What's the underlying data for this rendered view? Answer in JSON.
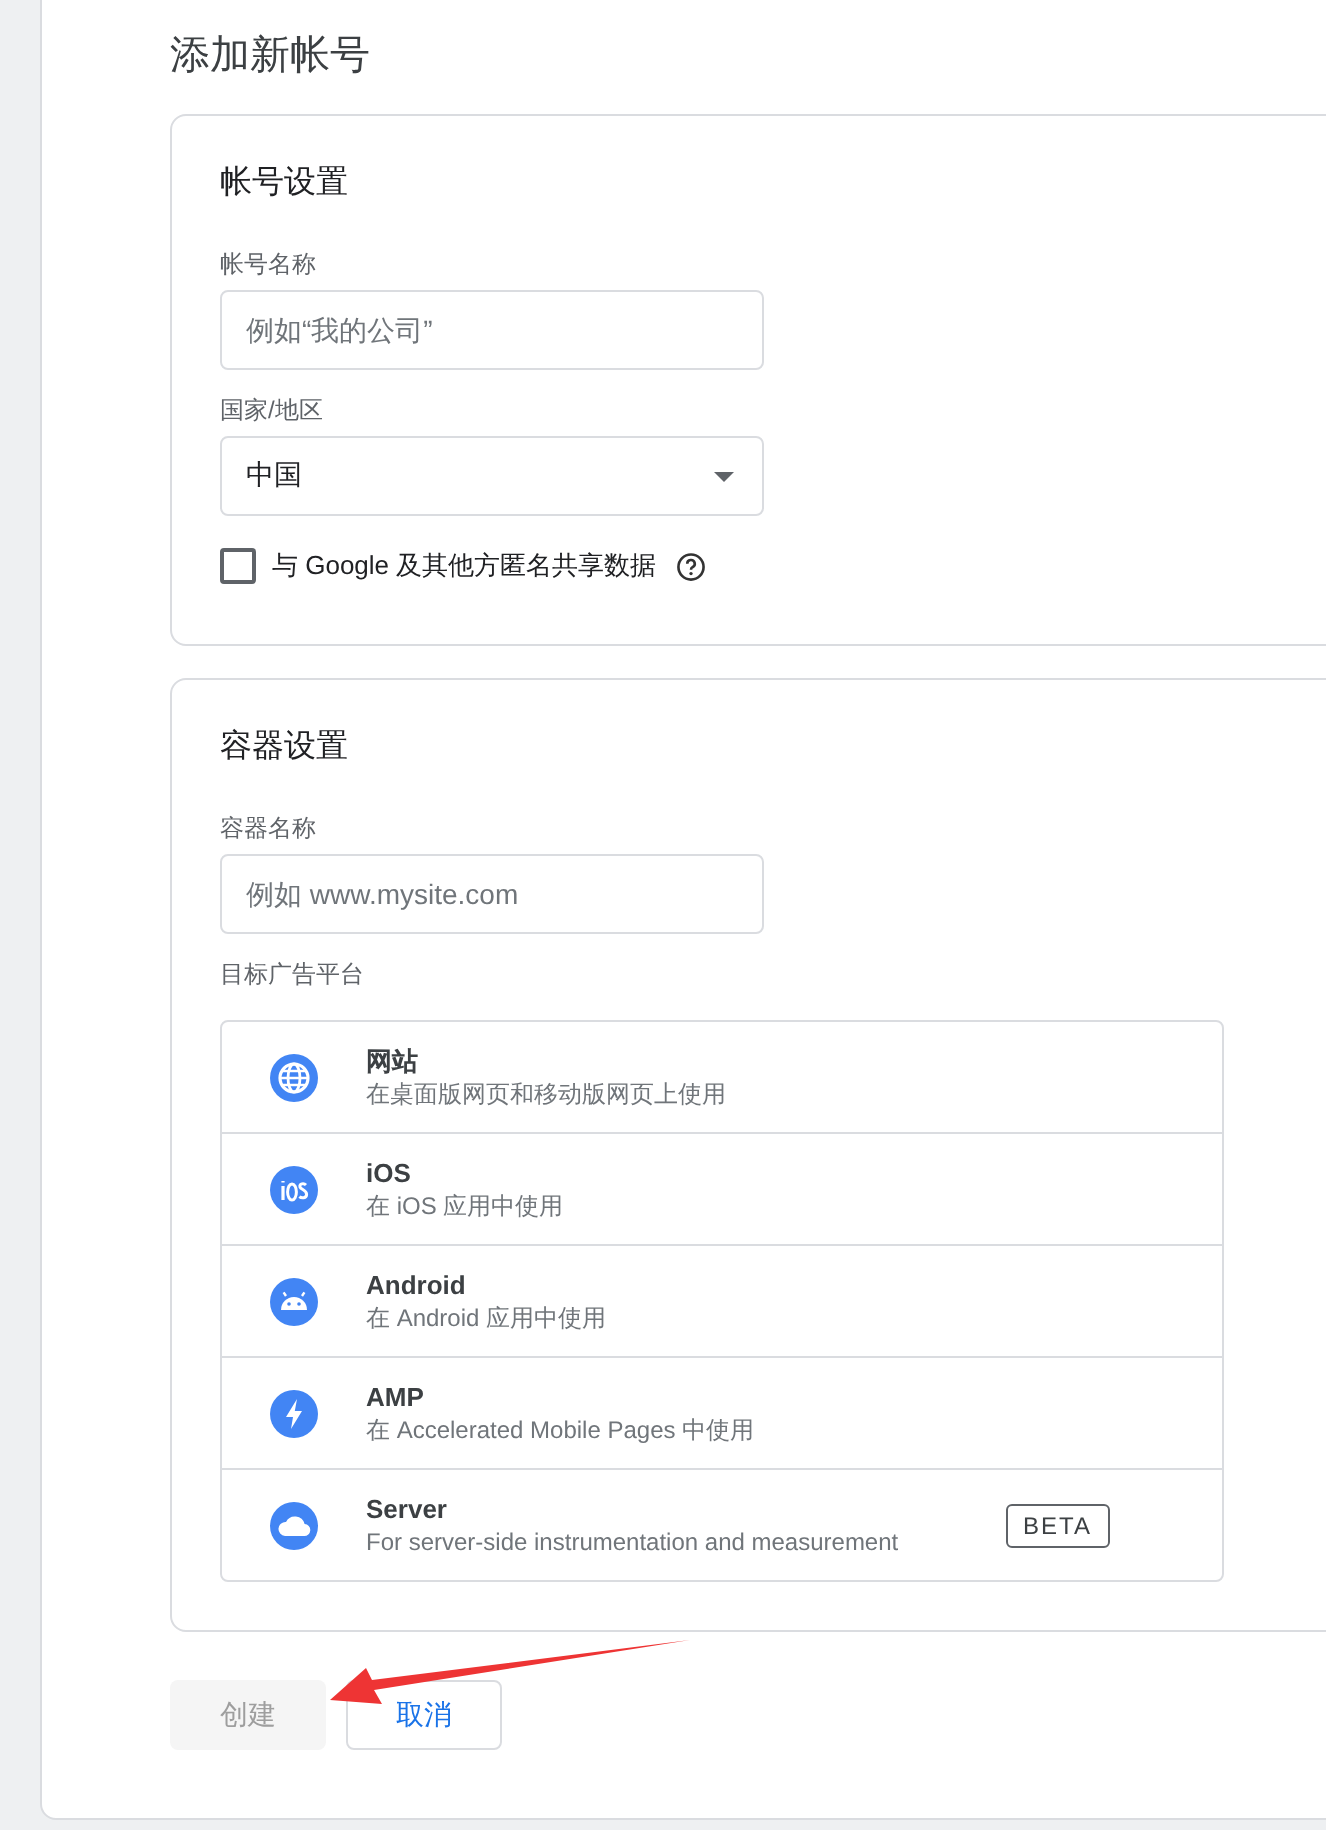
{
  "title": "添加新帐号",
  "account_settings": {
    "heading": "帐号设置",
    "name_label": "帐号名称",
    "name_placeholder": "例如“我的公司”",
    "country_label": "国家/地区",
    "country_value": "中国",
    "share_data": {
      "label": "与 Google 及其他方匿名共享数据",
      "checked": false
    }
  },
  "container_settings": {
    "heading": "容器设置",
    "name_label": "容器名称",
    "name_placeholder": "例如 www.mysite.com",
    "platform_label": "目标广告平台",
    "platforms": [
      {
        "kind": "web",
        "title": "网站",
        "description": "在桌面版网页和移动版网页上使用"
      },
      {
        "kind": "ios",
        "title": "iOS",
        "description": "在 iOS 应用中使用"
      },
      {
        "kind": "android",
        "title": "Android",
        "description": "在 Android 应用中使用"
      },
      {
        "kind": "amp",
        "title": "AMP",
        "description": "在 Accelerated Mobile Pages 中使用"
      },
      {
        "kind": "server",
        "title": "Server",
        "description": "For server-side instrumentation and measurement",
        "badge": "BETA"
      }
    ]
  },
  "buttons": [
    {
      "label": "创建",
      "disabled": true
    },
    {
      "label": "取消",
      "disabled": false
    }
  ]
}
